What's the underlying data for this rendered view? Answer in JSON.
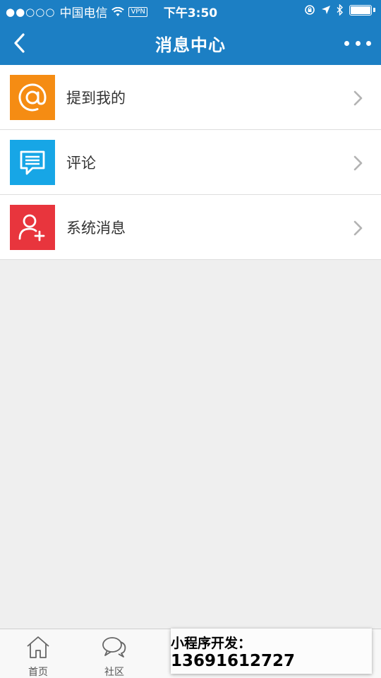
{
  "status_bar": {
    "signal": "●●○○○",
    "carrier": "中国电信",
    "vpn": "VPN",
    "time": "下午3:50"
  },
  "nav": {
    "title": "消息中心"
  },
  "items": [
    {
      "label": "提到我的",
      "icon": "at-icon",
      "color": "#f58c13"
    },
    {
      "label": "评论",
      "icon": "comment-icon",
      "color": "#17a6e6"
    },
    {
      "label": "系统消息",
      "icon": "add-user-icon",
      "color": "#e8353d"
    }
  ],
  "tab_bar": {
    "tabs": [
      {
        "label": "首页",
        "icon": "home-icon"
      },
      {
        "label": "社区",
        "icon": "community-icon"
      },
      {
        "label": "",
        "icon": ""
      },
      {
        "label": "",
        "icon": ""
      },
      {
        "label": "",
        "icon": ""
      }
    ]
  },
  "promo": {
    "prefix": "小程序开发：",
    "phone": "13691612727"
  }
}
